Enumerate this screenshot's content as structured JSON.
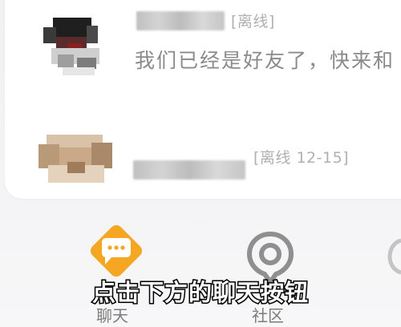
{
  "conversations": [
    {
      "name_hidden": true,
      "status": "[离线]",
      "preview": "我们已经是好友了，快来和"
    },
    {
      "name_hidden": true,
      "status": "[离线 12-15]"
    }
  ],
  "tabbar": {
    "chat": {
      "label": "聊天",
      "icon": "chat-bubble-icon",
      "color": "#f5a623"
    },
    "community": {
      "label": "社区",
      "icon": "community-pin-icon",
      "color": "#8f8f8f"
    }
  },
  "overlay": {
    "caption": "点击下方的聊天按钮"
  }
}
